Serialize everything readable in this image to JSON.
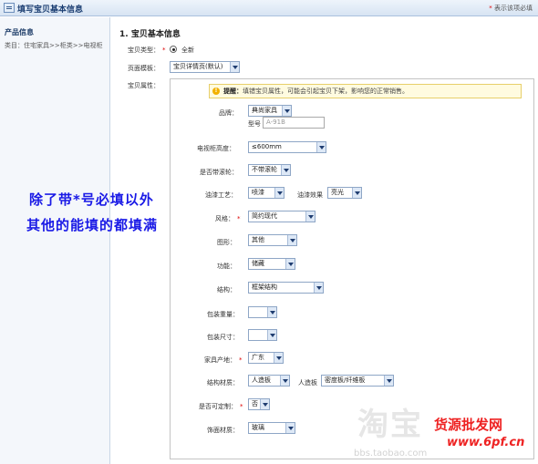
{
  "header": {
    "title": "填写宝贝基本信息",
    "note_star": "*",
    "note": "表示该项必填"
  },
  "sidebar": {
    "title": "产品信息",
    "category": "类目：住宅家具>>柜类>>电视柜"
  },
  "section": {
    "title": "1. 宝贝基本信息"
  },
  "fields": {
    "item_type": {
      "label": "宝贝类型：",
      "required": "*",
      "value": "全新"
    },
    "page_template": {
      "label": "页面模板：",
      "value": "宝贝详情页(默认)"
    },
    "attributes_label": "宝贝属性："
  },
  "tip": {
    "bold": "提醒：",
    "text": "填错宝贝属性，可能会引起宝贝下架，影响您的正常销售。"
  },
  "attributes": {
    "brand": {
      "label": "品牌：",
      "value": "典尚家具"
    },
    "model": {
      "label": "型号",
      "placeholder": "A-91B"
    },
    "tv_cabinet_height": {
      "label": "电视柜高度：",
      "value": "≤600mm"
    },
    "casters": {
      "label": "是否带滚轮：",
      "value": "不带滚轮"
    },
    "paint_process": {
      "label": "油漆工艺：",
      "value": "喷漆"
    },
    "paint_effect": {
      "label": "油漆效果",
      "value": "亮光"
    },
    "style": {
      "label": "风格：",
      "required": "*",
      "value": "简约现代"
    },
    "pattern": {
      "label": "图形：",
      "value": "其他"
    },
    "function": {
      "label": "功能：",
      "value": "储藏"
    },
    "structure": {
      "label": "结构：",
      "value": "框架结构"
    },
    "package_weight": {
      "label": "包装重量：",
      "value": ""
    },
    "package_size": {
      "label": "包装尺寸：",
      "value": ""
    },
    "origin": {
      "label": "家具产地：",
      "required": "*",
      "value": "广东"
    },
    "structure_material": {
      "label": "结构材质：",
      "value": "人造板"
    },
    "board_type": {
      "label": "人造板",
      "value": "密度板/纤维板"
    },
    "customizable": {
      "label": "是否可定制：",
      "required": "*",
      "value": "否"
    },
    "surface_material": {
      "label": "饰面材质：",
      "value": "玻璃"
    }
  },
  "overlay": {
    "line1": "除了带*号必填以外",
    "line2": "其他的能填的都填满"
  },
  "watermark": {
    "logo": "淘宝",
    "url": "bbs.taobao.com"
  },
  "brand": {
    "line1": "货源批发网",
    "line2": "www.6pf.cn"
  },
  "colors": {
    "required": "#dd0000",
    "overlay_text": "#1a1ae6",
    "brand": "#ee2222",
    "header_title": "#1c3f73"
  }
}
